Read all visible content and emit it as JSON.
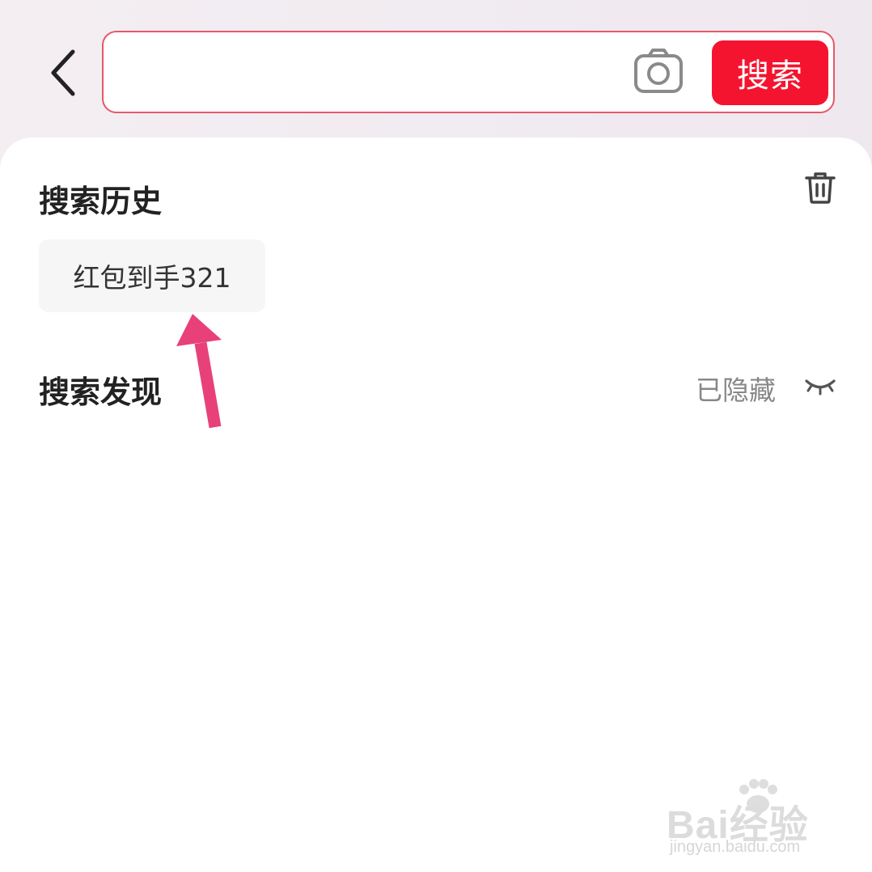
{
  "search": {
    "value": "",
    "placeholder": "",
    "button_label": "搜索"
  },
  "history": {
    "title": "搜索历史",
    "items": [
      "红包到手321"
    ]
  },
  "discover": {
    "title": "搜索发现",
    "status_label": "已隐藏"
  },
  "watermark": {
    "brand": "Bai经验",
    "sub": "jingyan.baidu.com"
  },
  "colors": {
    "accent": "#f5142f",
    "search_border": "#e5586a",
    "annotation_arrow": "#e8417a"
  },
  "icons": {
    "back": "chevron-left-icon",
    "camera": "camera-icon",
    "trash": "trash-icon",
    "hidden": "eye-closed-icon"
  }
}
